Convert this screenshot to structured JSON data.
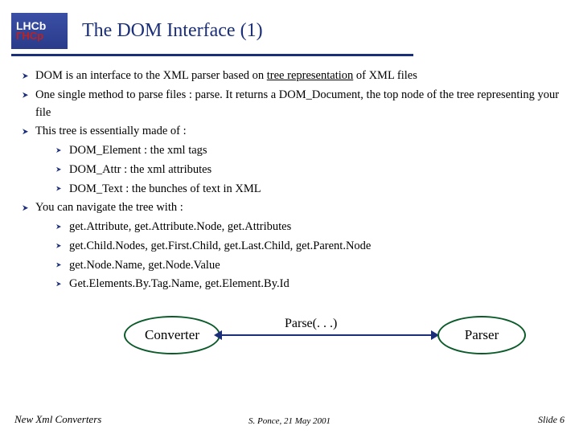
{
  "logo": {
    "line1": "LHCb",
    "line2": "ГНСр"
  },
  "title": "The DOM Interface (1)",
  "bullets": {
    "b1a": "DOM is an interface to the XML parser based on ",
    "b1b": "tree representation",
    "b1c": " of XML files",
    "b2a": "One single method to parse files : ",
    "b2b": "parse. It returns a DOM_Document, the top node of the tree representing your file",
    "b3": "This tree is essentially made of :",
    "b3s1": "DOM_Element : the xml tags",
    "b3s2": "DOM_Attr : the xml attributes",
    "b3s3": "DOM_Text : the bunches of text in XML",
    "b4": "You can navigate the tree with :",
    "b4s1": "get.Attribute, get.Attribute.Node, get.Attributes",
    "b4s2": "get.Child.Nodes, get.First.Child, get.Last.Child, get.Parent.Node",
    "b4s3": "get.Node.Name, get.Node.Value",
    "b4s4": "Get.Elements.By.Tag.Name, get.Element.By.Id"
  },
  "diagram": {
    "converter": "Converter",
    "parser": "Parser",
    "arrow_label": "Parse(. . .)"
  },
  "footer": {
    "left": "New Xml Converters",
    "center": "S. Ponce,  21 May 2001",
    "right": "Slide 6"
  }
}
